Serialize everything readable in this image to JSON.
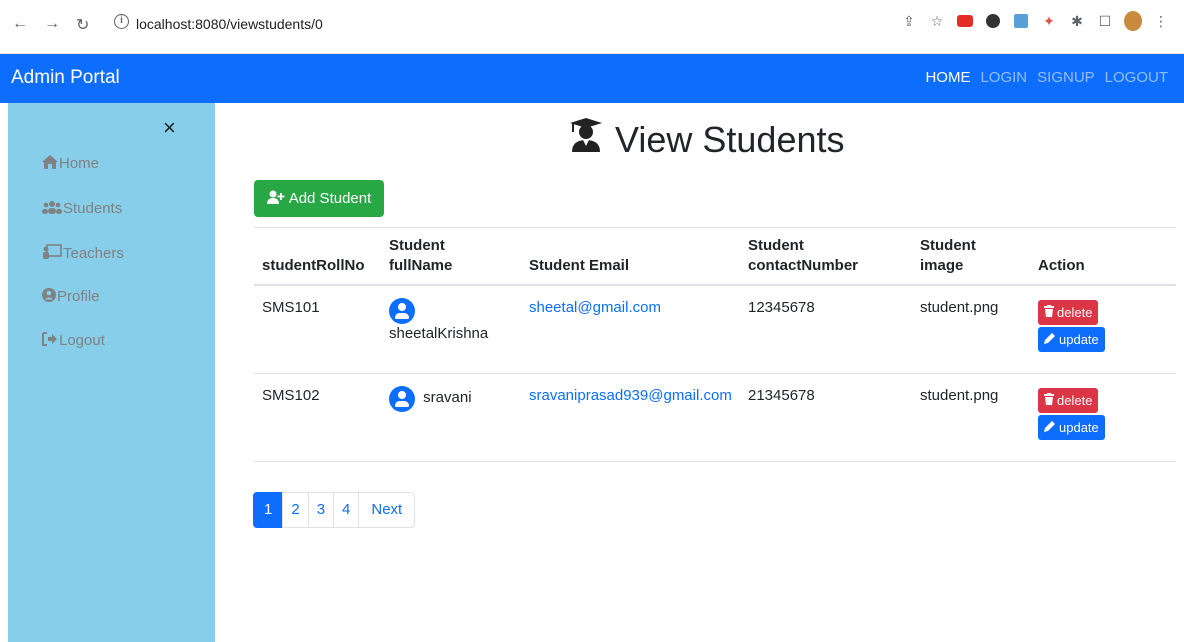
{
  "browser": {
    "url": "localhost:8080/viewstudents/0"
  },
  "navbar": {
    "brand": "Admin Portal",
    "links": [
      {
        "label": "HOME",
        "active": true
      },
      {
        "label": "LOGIN",
        "active": false
      },
      {
        "label": "SIGNUP",
        "active": false
      },
      {
        "label": "LOGOUT",
        "active": false
      }
    ]
  },
  "sidebar": {
    "close_glyph": "×",
    "items": [
      {
        "label": "Home",
        "icon": "home-icon"
      },
      {
        "label": "Students",
        "icon": "users-icon"
      },
      {
        "label": "Teachers",
        "icon": "chalkboard-teacher-icon"
      },
      {
        "label": "Profile",
        "icon": "user-circle-icon"
      },
      {
        "label": "Logout",
        "icon": "sign-out-icon"
      }
    ]
  },
  "main": {
    "title": "View Students",
    "add_button": "Add Student",
    "table": {
      "headers": [
        "studentRollNo",
        "Student fullName",
        "Student Email",
        "Student contactNumber",
        "Student image",
        "Action"
      ],
      "rows": [
        {
          "roll": "SMS101",
          "name": "sheetalKrishna",
          "email": "sheetal@gmail.com",
          "contact": "12345678",
          "image": "student.png"
        },
        {
          "roll": "SMS102",
          "name": "sravani",
          "email": "sravaniprasad939@gmail.com",
          "contact": "21345678",
          "image": "student.png"
        }
      ],
      "delete_label": "delete",
      "update_label": "update"
    },
    "pagination": {
      "pages": [
        "1",
        "2",
        "3",
        "4"
      ],
      "next": "Next"
    }
  },
  "colors": {
    "navbar": "#0d6efd",
    "sidebar": "#87ceeb",
    "add_button": "#28a745",
    "delete_button": "#dc3545",
    "update_button": "#0d6efd"
  }
}
